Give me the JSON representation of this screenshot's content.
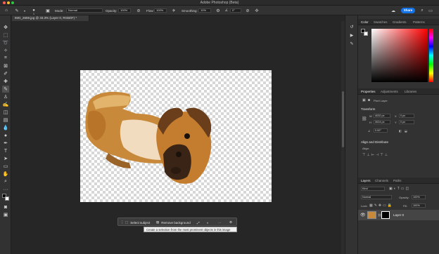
{
  "app": {
    "title": "Adobe Photoshop (Beta)"
  },
  "options_bar": {
    "mode_label": "Mode:",
    "mode_value": "Normal",
    "opacity_label": "Opacity:",
    "opacity_value": "100%",
    "flow_label": "Flow:",
    "flow_value": "100%",
    "smoothing_label": "Smoothing:",
    "smoothing_value": "10%",
    "brush_size": "1",
    "angle_value": "0°",
    "share_label": "Share"
  },
  "document": {
    "tab_label": "IMG_2659.jpg @ 33.3% (Layer 0, RGB/8*) *"
  },
  "contextual_taskbar": {
    "select_subject_label": "Select subject",
    "remove_background_label": "Remove background",
    "more_label": "···",
    "tooltip": "Create a selection from the most prominent objects in this image"
  },
  "color_panel": {
    "tabs": [
      "Color",
      "Swatches",
      "Gradients",
      "Patterns"
    ]
  },
  "properties_panel": {
    "tabs": [
      "Properties",
      "Adjustments",
      "Libraries"
    ],
    "pixel_layer_label": "Pixel Layer",
    "transform_title": "Transform",
    "w_label": "W",
    "w_value": "4032 px",
    "h_label": "H",
    "h_value": "3024 px",
    "x_label": "X",
    "x_value": "0 px",
    "y_label": "Y",
    "y_value": "0 px",
    "angle_value": "0.00°",
    "align_title": "Align and Distribute",
    "align_label": "Align:"
  },
  "layers_panel": {
    "tabs": [
      "Layers",
      "Channels",
      "Paths"
    ],
    "kind_label": "Kind",
    "blend_mode": "Normal",
    "opacity_label": "Opacity:",
    "opacity_value": "100%",
    "lock_label": "Lock:",
    "fill_label": "Fill:",
    "fill_value": "100%",
    "layer_name": "Layer 0"
  },
  "colors": {
    "accent": "#1473e6",
    "canvas_bg": "#262626",
    "panel_bg": "#323232"
  }
}
